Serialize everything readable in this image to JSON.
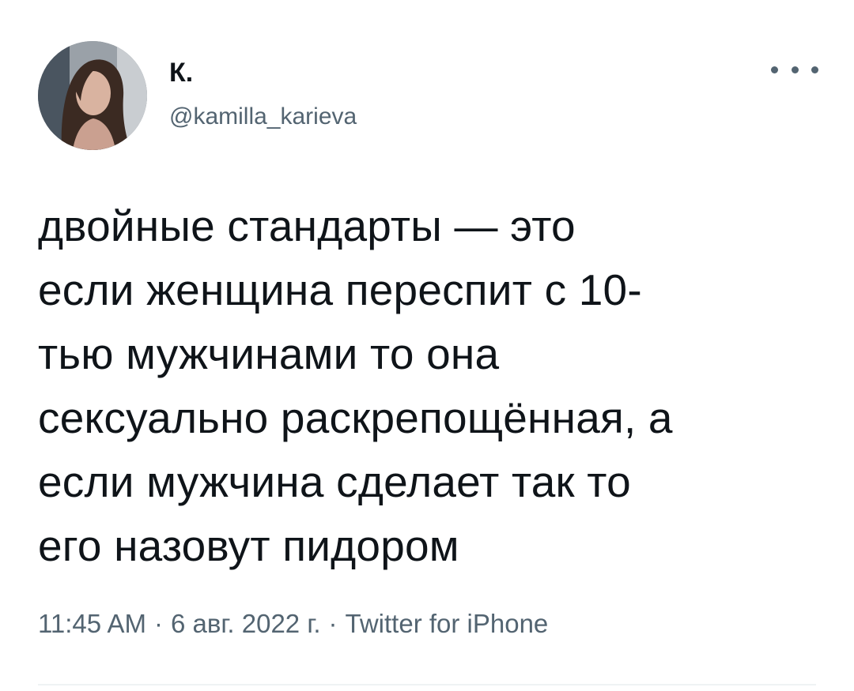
{
  "author": {
    "display_name": "К.",
    "handle": "@kamilla_karieva"
  },
  "more_icon": "more-horizontal-icon",
  "tweet": {
    "text_lines": [
      "двойные стандарты — это",
      "если женщина переспит с 10-",
      "тью мужчинами то она",
      "сексуально раскрепощённая, а",
      "если мужчина сделает так то",
      "его назовут пидором"
    ]
  },
  "meta": {
    "time": "11:45 AM",
    "separator": "·",
    "date": "6 авг. 2022 г.",
    "source": "Twitter for iPhone"
  },
  "colors": {
    "text": "#0f1419",
    "secondary": "#536471",
    "divider": "#eff3f4"
  }
}
